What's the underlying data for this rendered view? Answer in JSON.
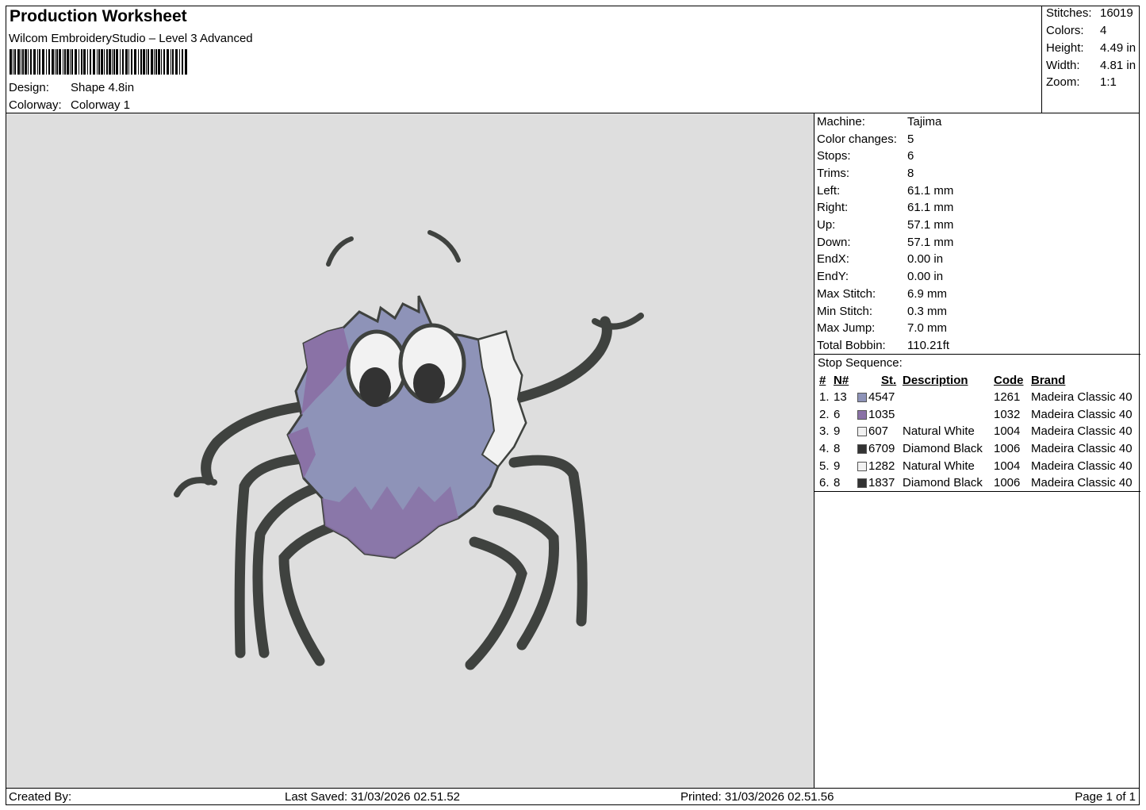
{
  "header": {
    "title": "Production Worksheet",
    "software": "Wilcom EmbroideryStudio – Level 3 Advanced",
    "design_label": "Design:",
    "design_value": "Shape 4.8in",
    "colorway_label": "Colorway:",
    "colorway_value": "Colorway 1"
  },
  "stats": [
    {
      "label": "Stitches:",
      "value": "16019"
    },
    {
      "label": "Colors:",
      "value": "4"
    },
    {
      "label": "Height:",
      "value": "4.49 in"
    },
    {
      "label": "Width:",
      "value": "4.81 in"
    },
    {
      "label": "Zoom:",
      "value": "1:1"
    }
  ],
  "info": [
    {
      "label": "Machine:",
      "value": "Tajima"
    },
    {
      "label": "Color changes:",
      "value": "5"
    },
    {
      "label": "Stops:",
      "value": "6"
    },
    {
      "label": "Trims:",
      "value": "8"
    },
    {
      "label": "Left:",
      "value": "61.1 mm"
    },
    {
      "label": "Right:",
      "value": "61.1 mm"
    },
    {
      "label": "Up:",
      "value": "57.1 mm"
    },
    {
      "label": "Down:",
      "value": "57.1 mm"
    },
    {
      "label": "EndX:",
      "value": "0.00 in"
    },
    {
      "label": "EndY:",
      "value": "0.00 in"
    },
    {
      "label": "Max Stitch:",
      "value": "6.9 mm"
    },
    {
      "label": "Min Stitch:",
      "value": "0.3 mm"
    },
    {
      "label": "Max Jump:",
      "value": "7.0 mm"
    },
    {
      "label": "Total Bobbin:",
      "value": "110.21ft"
    }
  ],
  "sequence": {
    "title": "Stop Sequence:",
    "headers": {
      "num": "#",
      "n": "N#",
      "st": "St.",
      "desc": "Description",
      "code": "Code",
      "brand": "Brand"
    },
    "rows": [
      {
        "num": "1.",
        "n": "13",
        "color": "#8e93b8",
        "st": "4547",
        "desc": "",
        "code": "1261",
        "brand": "Madeira Classic 40"
      },
      {
        "num": "2.",
        "n": "6",
        "color": "#8a72a6",
        "st": "1035",
        "desc": "",
        "code": "1032",
        "brand": "Madeira Classic 40"
      },
      {
        "num": "3.",
        "n": "9",
        "color": "#f2f2f2",
        "st": "607",
        "desc": "Natural White",
        "code": "1004",
        "brand": "Madeira Classic 40"
      },
      {
        "num": "4.",
        "n": "8",
        "color": "#333333",
        "st": "6709",
        "desc": "Diamond Black",
        "code": "1006",
        "brand": "Madeira Classic 40"
      },
      {
        "num": "5.",
        "n": "9",
        "color": "#f2f2f2",
        "st": "1282",
        "desc": "Natural White",
        "code": "1004",
        "brand": "Madeira Classic 40"
      },
      {
        "num": "6.",
        "n": "8",
        "color": "#333333",
        "st": "1837",
        "desc": "Diamond Black",
        "code": "1006",
        "brand": "Madeira Classic 40"
      }
    ]
  },
  "footer": {
    "created_by": "Created By:",
    "last_saved": "Last Saved: 31/03/2026 02.51.52",
    "printed": "Printed: 31/03/2026 02.51.56",
    "page": "Page 1 of 1"
  },
  "colors": {
    "canvas_bg": "#dedede",
    "outline": "#3f423f",
    "body_blue": "#8e93b8",
    "body_purple": "#8a72a6",
    "white": "#f2f2f2"
  }
}
